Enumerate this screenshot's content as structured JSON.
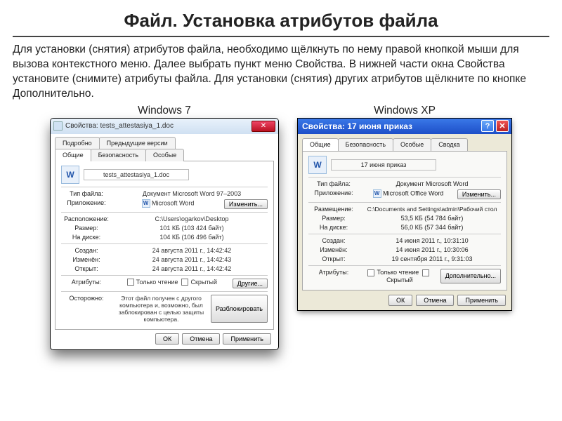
{
  "heading": "Файл. Установка атрибутов файла",
  "intro": "Для установки (снятия) атрибутов файла, необходимо щёлкнуть по нему правой кнопкой мыши для вызова контекстного меню. Далее выбрать пункт меню Свойства. В нижней части окна Свойства установите (снимите) атрибуты файла. Для установки (снятия) других атрибутов щёлкните по кнопке Дополнительно.",
  "labels": {
    "win7": "Windows 7",
    "winxp": "Windows XP"
  },
  "win7": {
    "title": "Свойства: tests_attestasiya_1.doc",
    "tabs_row1": [
      "Подробно",
      "Предыдущие версии"
    ],
    "tabs_row2": [
      "Общие",
      "Безопасность",
      "Особые"
    ],
    "filename": "tests_attestasiya_1.doc",
    "rows": {
      "type_k": "Тип файла:",
      "type_v": "Документ Microsoft Word 97–2003",
      "app_k": "Приложение:",
      "app_v": "Microsoft Word",
      "change_btn": "Изменить...",
      "loc_k": "Расположение:",
      "loc_v": "C:\\Users\\ogarkov\\Desktop",
      "size_k": "Размер:",
      "size_v": "101 КБ (103 424 байт)",
      "disk_k": "На диске:",
      "disk_v": "104 КБ (106 496 байт)",
      "created_k": "Создан:",
      "created_v": "24 августа 2011 г., 14:42:42",
      "mod_k": "Изменён:",
      "mod_v": "24 августа 2011 г., 14:42:43",
      "open_k": "Открыт:",
      "open_v": "24 августа 2011 г., 14:42:42",
      "attr_k": "Атрибуты:",
      "ro": "Только чтение",
      "hidden": "Скрытый",
      "other_btn": "Другие...",
      "warn_k": "Осторожно:",
      "warn_v": "Этот файл получен с другого компьютера и, возможно, был заблокирован с целью защиты компьютера.",
      "unblock_btn": "Разблокировать"
    },
    "buttons": {
      "ok": "ОК",
      "cancel": "Отмена",
      "apply": "Применить"
    }
  },
  "winxp": {
    "title": "Свойства: 17 июня приказ",
    "tabs": [
      "Общие",
      "Безопасность",
      "Особые",
      "Сводка"
    ],
    "filename": "17 июня приказ",
    "rows": {
      "type_k": "Тип файла:",
      "type_v": "Документ Microsoft Word",
      "app_k": "Приложение:",
      "app_v": "Microsoft Office Word",
      "change_btn": "Изменить...",
      "loc_k": "Размещение:",
      "loc_v": "C:\\Documents and Settings\\admin\\Рабочий стол",
      "size_k": "Размер:",
      "size_v": "53,5 КБ (54 784 байт)",
      "disk_k": "На диске:",
      "disk_v": "56,0 КБ (57 344 байт)",
      "created_k": "Создан:",
      "created_v": "14 июня 2011 г., 10:31:10",
      "mod_k": "Изменён:",
      "mod_v": "14 июня 2011 г., 10:30:06",
      "open_k": "Открыт:",
      "open_v": "19 сентября 2011 г., 9:31:03",
      "attr_k": "Атрибуты:",
      "ro": "Только чтение",
      "hidden": "Скрытый",
      "adv_btn": "Дополнительно..."
    },
    "buttons": {
      "ok": "ОК",
      "cancel": "Отмена",
      "apply": "Применить"
    }
  }
}
